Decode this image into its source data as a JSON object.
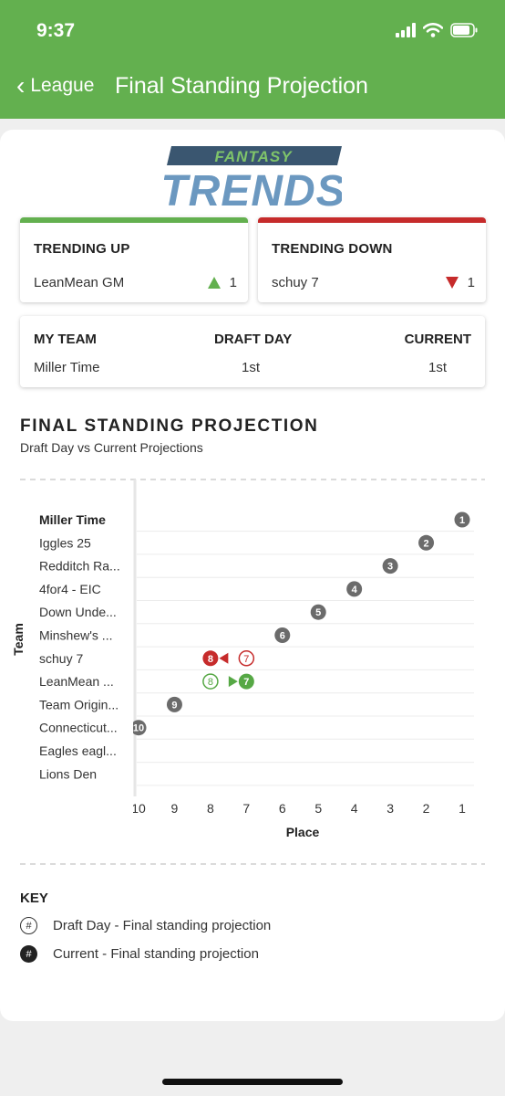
{
  "status": {
    "time": "9:37"
  },
  "nav": {
    "back_label": "League",
    "title": "Final Standing Projection"
  },
  "logo": {
    "top": "FANTASY",
    "main": "TRENDS"
  },
  "trending_up": {
    "heading": "TRENDING UP",
    "team": "LeanMean GM",
    "change": "1"
  },
  "trending_down": {
    "heading": "TRENDING DOWN",
    "team": "schuy 7",
    "change": "1"
  },
  "my_team": {
    "headers": [
      "MY TEAM",
      "DRAFT DAY",
      "CURRENT"
    ],
    "team": "Miller Time",
    "draft_day": "1st",
    "current": "1st"
  },
  "section": {
    "title": "FINAL STANDING PROJECTION",
    "subtitle": "Draft Day vs Current Projections"
  },
  "chart_data": {
    "type": "scatter",
    "title": "",
    "xlabel": "Place",
    "ylabel": "Team",
    "xlim": [
      10,
      1
    ],
    "x_ticks": [
      "10",
      "9",
      "8",
      "7",
      "6",
      "5",
      "4",
      "3",
      "2",
      "1"
    ],
    "categories": [
      "Miller Time",
      "Iggles 25",
      "Redditch Ra...",
      "4for4 - EIC",
      "Down Unde...",
      "Minshew's ...",
      "schuy 7",
      "LeanMean ...",
      "Team Origin...",
      "Connecticut...",
      "Eagles eagl...",
      "Lions Den"
    ],
    "points": [
      {
        "team": "Miller Time",
        "draft": 1,
        "current": 1
      },
      {
        "team": "Iggles 25",
        "draft": 2,
        "current": 2
      },
      {
        "team": "Redditch Ra...",
        "draft": 3,
        "current": 3
      },
      {
        "team": "4for4 - EIC",
        "draft": 4,
        "current": 4
      },
      {
        "team": "Down Unde...",
        "draft": 5,
        "current": 5
      },
      {
        "team": "Minshew's ...",
        "draft": 6,
        "current": 6
      },
      {
        "team": "schuy 7",
        "draft": 7,
        "current": 8
      },
      {
        "team": "LeanMean ...",
        "draft": 8,
        "current": 7
      },
      {
        "team": "Team Origin...",
        "draft": 9,
        "current": 9
      },
      {
        "team": "Connecticut...",
        "draft": 10,
        "current": 10
      }
    ],
    "highlight_team": "Miller Time",
    "colors": {
      "neutral": "#6b6b6b",
      "up": "#56a845",
      "down": "#c62b2b"
    },
    "grid": true
  },
  "key": {
    "title": "KEY",
    "icon_symbol": "#",
    "draft_label": "Draft Day - Final standing projection",
    "current_label": "Current - Final standing projection"
  }
}
